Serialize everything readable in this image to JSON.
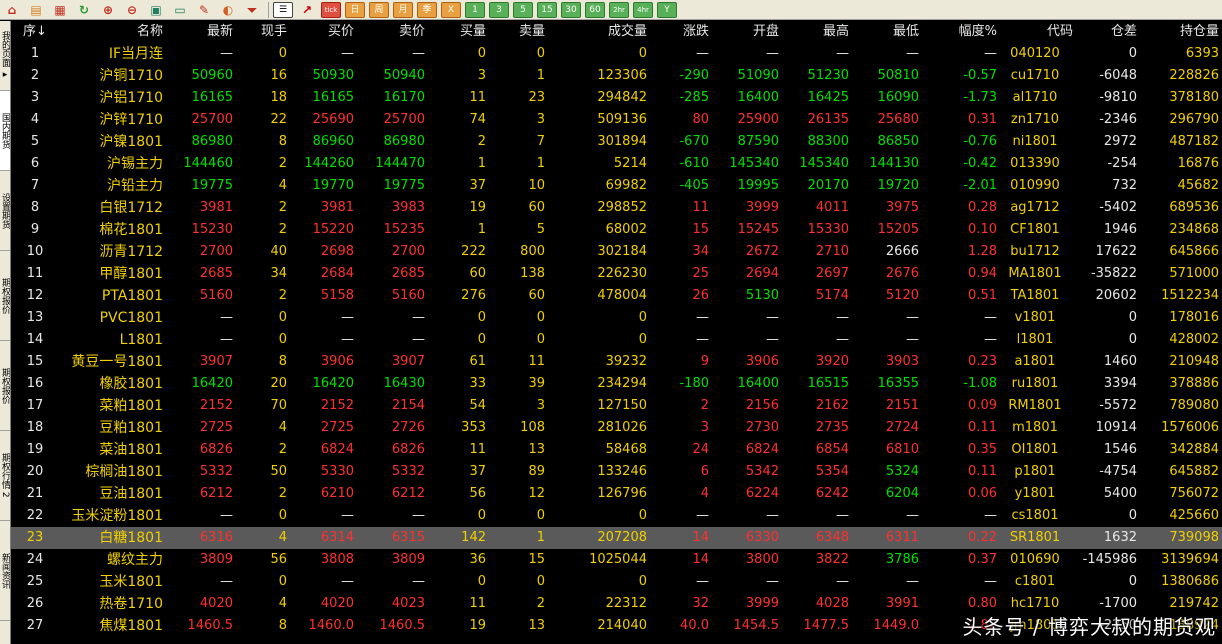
{
  "colors": {
    "up": "#ff3030",
    "down": "#00e000",
    "flat": "#e8e8e8",
    "label": "#f0d000",
    "bg": "#000000"
  },
  "toolbar": {
    "icons": [
      "home-icon",
      "page-icon",
      "report-icon",
      "refresh-icon",
      "zoom-in-icon",
      "zoom-out-icon",
      "window-icon",
      "minimize-icon",
      "pen-icon",
      "palette-icon",
      "filter-icon"
    ],
    "buttons": [
      {
        "label": "☰",
        "icon": "list-icon",
        "style": "active"
      },
      {
        "label": "↗",
        "icon": "chart-icon",
        "style": "plain"
      },
      {
        "label": "tick",
        "style": "red"
      },
      {
        "label": "日",
        "style": "orange"
      },
      {
        "label": "周",
        "style": "orange"
      },
      {
        "label": "月",
        "style": "orange"
      },
      {
        "label": "季",
        "style": "orange"
      },
      {
        "label": "X",
        "style": "orange"
      },
      {
        "label": "1",
        "style": "green"
      },
      {
        "label": "3",
        "style": "green"
      },
      {
        "label": "5",
        "style": "green"
      },
      {
        "label": "15",
        "style": "green"
      },
      {
        "label": "30",
        "style": "green"
      },
      {
        "label": "60",
        "style": "green"
      },
      {
        "label": "2hr",
        "style": "green"
      },
      {
        "label": "4hr",
        "style": "green"
      },
      {
        "label": "Y",
        "style": "green"
      }
    ]
  },
  "sidetabs": [
    {
      "label": "我的页面 ▸",
      "active": false
    },
    {
      "label": "国内期货",
      "active": true
    },
    {
      "label": "设置期货",
      "active": false
    },
    {
      "label": "期权报价",
      "active": false
    },
    {
      "label": "期权报价",
      "active": false
    },
    {
      "label": "期权行情 2",
      "active": false
    },
    {
      "label": "新闻资讯",
      "active": false
    }
  ],
  "headers": [
    "序↓",
    "名称",
    "最新",
    "现手",
    "买价",
    "卖价",
    "买量",
    "卖量",
    "成交量",
    "涨跌",
    "开盘",
    "最高",
    "最低",
    "幅度%",
    "代码",
    "仓差",
    "持仓量"
  ],
  "rows": [
    {
      "seq": "1",
      "name": "IF当月连",
      "last": "—",
      "vol": "0",
      "bid": "—",
      "ask": "—",
      "bidv": "0",
      "askv": "0",
      "tvol": "0",
      "chg": "—",
      "open": "—",
      "high": "—",
      "low": "—",
      "pct": "—",
      "code": "040120",
      "oi_chg": "0",
      "oi": "6393",
      "dir": "flat"
    },
    {
      "seq": "2",
      "name": "沪铜1710",
      "last": "50960",
      "vol": "16",
      "bid": "50930",
      "ask": "50940",
      "bidv": "3",
      "askv": "1",
      "tvol": "123306",
      "chg": "-290",
      "open": "51090",
      "high": "51230",
      "low": "50810",
      "pct": "-0.57",
      "code": "cu1710",
      "oi_chg": "-6048",
      "oi": "228826",
      "dir": "down"
    },
    {
      "seq": "3",
      "name": "沪铝1710",
      "last": "16165",
      "vol": "18",
      "bid": "16165",
      "ask": "16170",
      "bidv": "11",
      "askv": "23",
      "tvol": "294842",
      "chg": "-285",
      "open": "16400",
      "high": "16425",
      "low": "16090",
      "pct": "-1.73",
      "code": "al1710",
      "oi_chg": "-9810",
      "oi": "378180",
      "dir": "down"
    },
    {
      "seq": "4",
      "name": "沪锌1710",
      "last": "25700",
      "vol": "22",
      "bid": "25690",
      "ask": "25700",
      "bidv": "74",
      "askv": "3",
      "tvol": "509136",
      "chg": "80",
      "open": "25900",
      "high": "26135",
      "low": "25680",
      "pct": "0.31",
      "code": "zn1710",
      "oi_chg": "-2346",
      "oi": "296790",
      "dir": "up"
    },
    {
      "seq": "5",
      "name": "沪镍1801",
      "last": "86980",
      "vol": "8",
      "bid": "86960",
      "ask": "86980",
      "bidv": "2",
      "askv": "7",
      "tvol": "301894",
      "chg": "-670",
      "open": "87590",
      "high": "88300",
      "low": "86850",
      "pct": "-0.76",
      "code": "ni1801",
      "oi_chg": "2972",
      "oi": "487182",
      "dir": "down"
    },
    {
      "seq": "6",
      "name": "沪锡主力",
      "last": "144460",
      "vol": "2",
      "bid": "144260",
      "ask": "144470",
      "bidv": "1",
      "askv": "1",
      "tvol": "5214",
      "chg": "-610",
      "open": "145340",
      "high": "145340",
      "low": "144130",
      "pct": "-0.42",
      "code": "013390",
      "oi_chg": "-254",
      "oi": "16876",
      "dir": "down"
    },
    {
      "seq": "7",
      "name": "沪铅主力",
      "last": "19775",
      "vol": "4",
      "bid": "19770",
      "ask": "19775",
      "bidv": "37",
      "askv": "10",
      "tvol": "69982",
      "chg": "-405",
      "open": "19995",
      "high": "20170",
      "low": "19720",
      "pct": "-2.01",
      "code": "010990",
      "oi_chg": "732",
      "oi": "45682",
      "dir": "down"
    },
    {
      "seq": "8",
      "name": "白银1712",
      "last": "3981",
      "vol": "2",
      "bid": "3981",
      "ask": "3983",
      "bidv": "19",
      "askv": "60",
      "tvol": "298852",
      "chg": "11",
      "open": "3999",
      "high": "4011",
      "low": "3975",
      "pct": "0.28",
      "code": "ag1712",
      "oi_chg": "-5402",
      "oi": "689536",
      "dir": "up"
    },
    {
      "seq": "9",
      "name": "棉花1801",
      "last": "15230",
      "vol": "2",
      "bid": "15220",
      "ask": "15235",
      "bidv": "1",
      "askv": "5",
      "tvol": "68002",
      "chg": "15",
      "open": "15245",
      "high": "15330",
      "low": "15205",
      "pct": "0.10",
      "code": "CF1801",
      "oi_chg": "1946",
      "oi": "234868",
      "dir": "up"
    },
    {
      "seq": "10",
      "name": "沥青1712",
      "last": "2700",
      "vol": "40",
      "bid": "2698",
      "ask": "2700",
      "bidv": "222",
      "askv": "800",
      "tvol": "302184",
      "chg": "34",
      "open": "2672",
      "high": "2710",
      "low": "2666",
      "pct": "1.28",
      "code": "bu1712",
      "oi_chg": "17622",
      "oi": "645866",
      "dir": "up"
    },
    {
      "seq": "11",
      "name": "甲醇1801",
      "last": "2685",
      "vol": "34",
      "bid": "2684",
      "ask": "2685",
      "bidv": "60",
      "askv": "138",
      "tvol": "226230",
      "chg": "25",
      "open": "2694",
      "high": "2697",
      "low": "2676",
      "pct": "0.94",
      "code": "MA1801",
      "oi_chg": "-35822",
      "oi": "571000",
      "dir": "up"
    },
    {
      "seq": "12",
      "name": "PTA1801",
      "last": "5160",
      "vol": "2",
      "bid": "5158",
      "ask": "5160",
      "bidv": "276",
      "askv": "60",
      "tvol": "478004",
      "chg": "26",
      "open": "5130",
      "high": "5174",
      "low": "5120",
      "pct": "0.51",
      "code": "TA1801",
      "oi_chg": "20602",
      "oi": "1512234",
      "dir": "up"
    },
    {
      "seq": "13",
      "name": "PVC1801",
      "last": "—",
      "vol": "0",
      "bid": "—",
      "ask": "—",
      "bidv": "0",
      "askv": "0",
      "tvol": "0",
      "chg": "—",
      "open": "—",
      "high": "—",
      "low": "—",
      "pct": "—",
      "code": "v1801",
      "oi_chg": "0",
      "oi": "178016",
      "dir": "flat"
    },
    {
      "seq": "14",
      "name": "L1801",
      "last": "—",
      "vol": "0",
      "bid": "—",
      "ask": "—",
      "bidv": "0",
      "askv": "0",
      "tvol": "0",
      "chg": "—",
      "open": "—",
      "high": "—",
      "low": "—",
      "pct": "—",
      "code": "l1801",
      "oi_chg": "0",
      "oi": "428002",
      "dir": "flat"
    },
    {
      "seq": "15",
      "name": "黄豆一号1801",
      "last": "3907",
      "vol": "8",
      "bid": "3906",
      "ask": "3907",
      "bidv": "61",
      "askv": "11",
      "tvol": "39232",
      "chg": "9",
      "open": "3906",
      "high": "3920",
      "low": "3903",
      "pct": "0.23",
      "code": "a1801",
      "oi_chg": "1460",
      "oi": "210948",
      "dir": "up"
    },
    {
      "seq": "16",
      "name": "橡胶1801",
      "last": "16420",
      "vol": "20",
      "bid": "16420",
      "ask": "16430",
      "bidv": "33",
      "askv": "39",
      "tvol": "234294",
      "chg": "-180",
      "open": "16400",
      "high": "16515",
      "low": "16355",
      "pct": "-1.08",
      "code": "ru1801",
      "oi_chg": "3394",
      "oi": "378886",
      "dir": "down"
    },
    {
      "seq": "17",
      "name": "菜粕1801",
      "last": "2152",
      "vol": "70",
      "bid": "2152",
      "ask": "2154",
      "bidv": "54",
      "askv": "3",
      "tvol": "127150",
      "chg": "2",
      "open": "2156",
      "high": "2162",
      "low": "2151",
      "pct": "0.09",
      "code": "RM1801",
      "oi_chg": "-5572",
      "oi": "789080",
      "dir": "up"
    },
    {
      "seq": "18",
      "name": "豆粕1801",
      "last": "2725",
      "vol": "4",
      "bid": "2725",
      "ask": "2726",
      "bidv": "353",
      "askv": "108",
      "tvol": "281026",
      "chg": "3",
      "open": "2730",
      "high": "2735",
      "low": "2724",
      "pct": "0.11",
      "code": "m1801",
      "oi_chg": "10914",
      "oi": "1576006",
      "dir": "up"
    },
    {
      "seq": "19",
      "name": "菜油1801",
      "last": "6826",
      "vol": "2",
      "bid": "6824",
      "ask": "6826",
      "bidv": "11",
      "askv": "13",
      "tvol": "58468",
      "chg": "24",
      "open": "6824",
      "high": "6854",
      "low": "6810",
      "pct": "0.35",
      "code": "OI1801",
      "oi_chg": "1546",
      "oi": "342884",
      "dir": "up"
    },
    {
      "seq": "20",
      "name": "棕榈油1801",
      "last": "5332",
      "vol": "50",
      "bid": "5330",
      "ask": "5332",
      "bidv": "37",
      "askv": "89",
      "tvol": "133246",
      "chg": "6",
      "open": "5342",
      "high": "5354",
      "low": "5324",
      "pct": "0.11",
      "code": "p1801",
      "oi_chg": "-4754",
      "oi": "645882",
      "dir": "up"
    },
    {
      "seq": "21",
      "name": "豆油1801",
      "last": "6212",
      "vol": "2",
      "bid": "6210",
      "ask": "6212",
      "bidv": "56",
      "askv": "12",
      "tvol": "126796",
      "chg": "4",
      "open": "6224",
      "high": "6242",
      "low": "6204",
      "pct": "0.06",
      "code": "y1801",
      "oi_chg": "5400",
      "oi": "756072",
      "dir": "up"
    },
    {
      "seq": "22",
      "name": "玉米淀粉1801",
      "last": "—",
      "vol": "0",
      "bid": "—",
      "ask": "—",
      "bidv": "0",
      "askv": "0",
      "tvol": "0",
      "chg": "—",
      "open": "—",
      "high": "—",
      "low": "—",
      "pct": "—",
      "code": "cs1801",
      "oi_chg": "0",
      "oi": "425660",
      "dir": "flat"
    },
    {
      "seq": "23",
      "name": "白糖1801",
      "last": "6316",
      "vol": "4",
      "bid": "6314",
      "ask": "6315",
      "bidv": "142",
      "askv": "1",
      "tvol": "207208",
      "chg": "14",
      "open": "6330",
      "high": "6348",
      "low": "6311",
      "pct": "0.22",
      "code": "SR1801",
      "oi_chg": "1632",
      "oi": "739098",
      "dir": "up",
      "selected": true
    },
    {
      "seq": "24",
      "name": "螺纹主力",
      "last": "3809",
      "vol": "56",
      "bid": "3808",
      "ask": "3809",
      "bidv": "36",
      "askv": "15",
      "tvol": "1025044",
      "chg": "14",
      "open": "3800",
      "high": "3822",
      "low": "3786",
      "pct": "0.37",
      "code": "010690",
      "oi_chg": "-145986",
      "oi": "3139694",
      "dir": "up"
    },
    {
      "seq": "25",
      "name": "玉米1801",
      "last": "—",
      "vol": "0",
      "bid": "—",
      "ask": "—",
      "bidv": "0",
      "askv": "0",
      "tvol": "0",
      "chg": "—",
      "open": "—",
      "high": "—",
      "low": "—",
      "pct": "—",
      "code": "c1801",
      "oi_chg": "0",
      "oi": "1380686",
      "dir": "flat"
    },
    {
      "seq": "26",
      "name": "热卷1710",
      "last": "4020",
      "vol": "4",
      "bid": "4020",
      "ask": "4023",
      "bidv": "11",
      "askv": "2",
      "tvol": "22312",
      "chg": "32",
      "open": "3999",
      "high": "4028",
      "low": "3991",
      "pct": "0.80",
      "code": "hc1710",
      "oi_chg": "-1700",
      "oi": "219742",
      "dir": "up"
    },
    {
      "seq": "27",
      "name": "焦煤1801",
      "last": "1460.5",
      "vol": "8",
      "bid": "1460.0",
      "ask": "1460.5",
      "bidv": "19",
      "askv": "13",
      "tvol": "214040",
      "chg": "40.0",
      "open": "1454.5",
      "high": "1477.5",
      "low": "1449.0",
      "pct": "2.82",
      "code": "jm1801",
      "oi_chg": "-2250",
      "oi": "138924",
      "dir": "up"
    }
  ],
  "watermark": "头条号 / 博弈大叔的期货观"
}
